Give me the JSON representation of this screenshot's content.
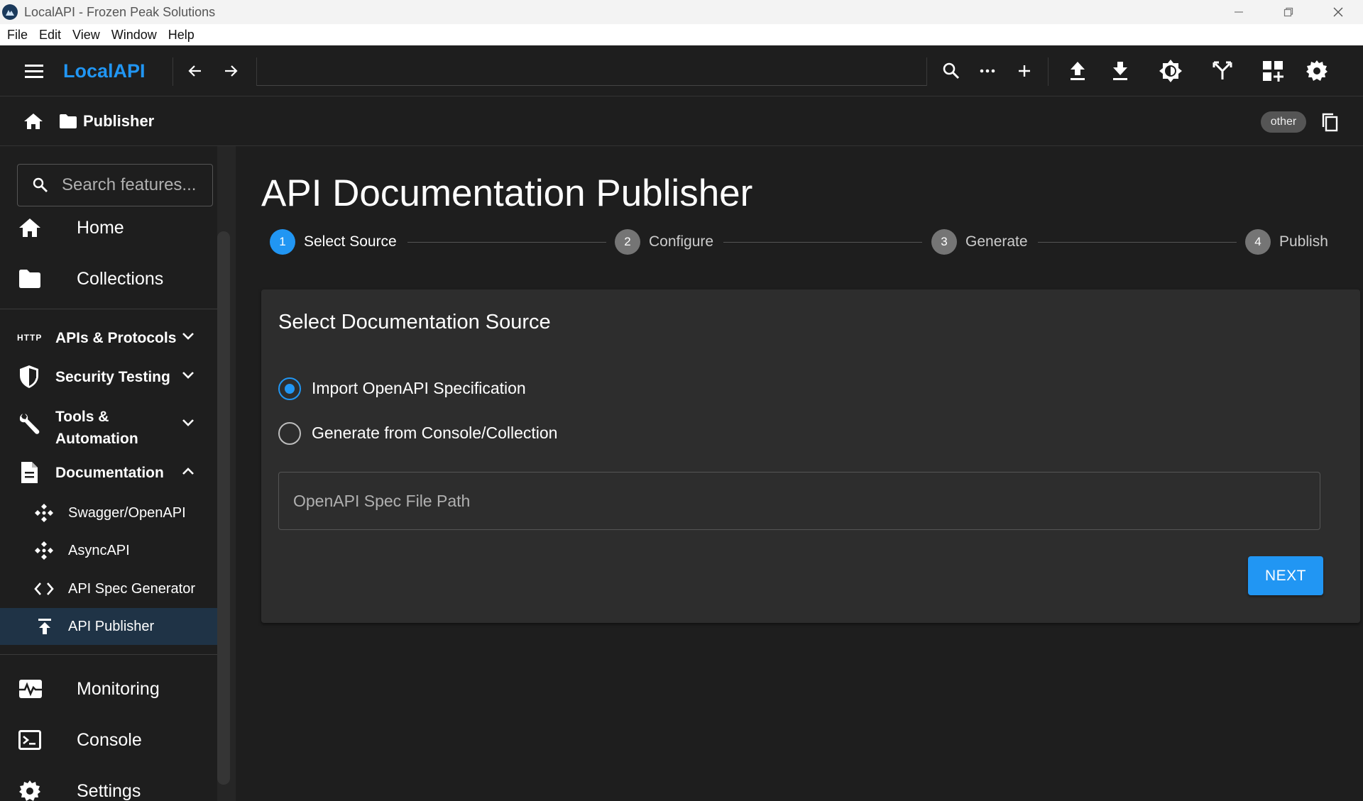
{
  "window": {
    "title": "LocalAPI - Frozen Peak Solutions",
    "controls": [
      "minimize-icon",
      "restore-icon",
      "close-icon"
    ]
  },
  "menubar": {
    "items": [
      "File",
      "Edit",
      "View",
      "Window",
      "Help"
    ]
  },
  "toolbar": {
    "logo": "LocalAPI",
    "icons": [
      "menu-icon",
      "back-arrow-icon",
      "forward-arrow-icon",
      "search-icon",
      "more-icon",
      "add-icon",
      "upload-icon",
      "download-icon",
      "theme-icon",
      "fork-icon",
      "add-widget-icon",
      "settings-icon"
    ]
  },
  "breadcrumb": {
    "label": "Publisher",
    "chip": "other"
  },
  "sidebar": {
    "search_placeholder": "Search features...",
    "items": [
      {
        "label": "Home",
        "icon": "home-icon"
      },
      {
        "label": "Collections",
        "icon": "folder-icon"
      },
      {
        "label": "APIs & Protocols",
        "icon": "http-icon",
        "http_text": "HTTP"
      },
      {
        "label": "Security Testing",
        "icon": "shield-icon"
      },
      {
        "label": "Tools &",
        "label2": "Automation",
        "icon": "wrench-icon"
      },
      {
        "label": "Documentation",
        "icon": "document-icon"
      },
      {
        "label": "Swagger/OpenAPI",
        "icon": "api-icon"
      },
      {
        "label": "AsyncAPI",
        "icon": "api-icon"
      },
      {
        "label": "API Spec Generator",
        "icon": "code-icon"
      },
      {
        "label": "API Publisher",
        "icon": "publish-icon"
      },
      {
        "label": "Monitoring",
        "icon": "monitor-icon"
      },
      {
        "label": "Console",
        "icon": "terminal-icon"
      },
      {
        "label": "Settings",
        "icon": "settings-icon"
      }
    ]
  },
  "main": {
    "title": "API Documentation Publisher",
    "steps": [
      {
        "num": "1",
        "label": "Select Source",
        "active": true
      },
      {
        "num": "2",
        "label": "Configure",
        "active": false
      },
      {
        "num": "3",
        "label": "Generate",
        "active": false
      },
      {
        "num": "4",
        "label": "Publish",
        "active": false
      }
    ],
    "card": {
      "title": "Select Documentation Source",
      "options": [
        {
          "label": "Import OpenAPI Specification",
          "selected": true
        },
        {
          "label": "Generate from Console/Collection",
          "selected": false
        }
      ],
      "field_placeholder": "OpenAPI Spec File Path",
      "field_value": "",
      "next_label": "NEXT"
    }
  },
  "colors": {
    "accent": "#2196f3",
    "background": "#1e1e1e",
    "card": "#2d2d2d",
    "active_nav": "#1f3346"
  }
}
